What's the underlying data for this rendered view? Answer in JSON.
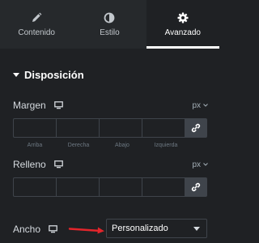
{
  "tabs": [
    {
      "label": "Contenido",
      "icon": "pencil-icon",
      "active": false
    },
    {
      "label": "Estilo",
      "icon": "contrast-icon",
      "active": false
    },
    {
      "label": "Avanzado",
      "icon": "gear-icon",
      "active": true
    }
  ],
  "section": {
    "title": "Disposición"
  },
  "margen": {
    "label": "Margen",
    "unit": "px",
    "fields": [
      "Arriba",
      "Derecha",
      "Abajo",
      "Izquierda"
    ]
  },
  "relleno": {
    "label": "Relleno",
    "unit": "px"
  },
  "ancho": {
    "label": "Ancho",
    "value": "Personalizado"
  },
  "colors": {
    "background": "#1f2124",
    "tabs_bg": "#26292c",
    "border": "#3f444b",
    "arrow": "#e3252b"
  }
}
